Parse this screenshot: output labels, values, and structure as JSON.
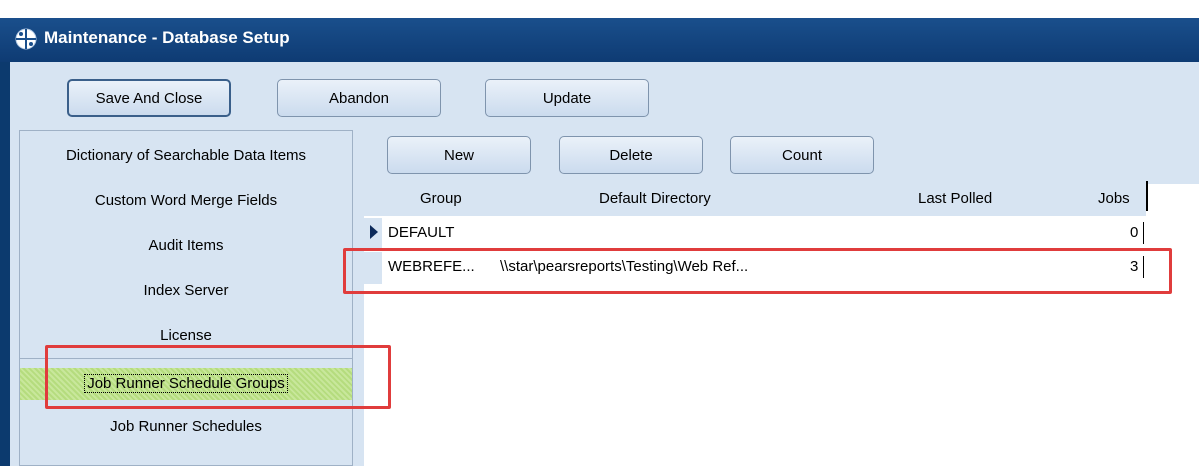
{
  "window": {
    "title": "Maintenance - Database Setup",
    "icon": "database-setup-icon"
  },
  "toolbar": {
    "save_label": "Save And Close",
    "abandon_label": "Abandon",
    "update_label": "Update"
  },
  "sidebar": {
    "items": [
      {
        "label": "Dictionary of Searchable Data Items"
      },
      {
        "label": "Custom Word Merge Fields"
      },
      {
        "label": "Audit Items"
      },
      {
        "label": "Index Server"
      },
      {
        "label": "License"
      },
      {
        "label": "Job Runner Schedule Groups",
        "selected": true
      },
      {
        "label": "Job Runner Schedules"
      }
    ]
  },
  "grid_toolbar": {
    "new_label": "New",
    "delete_label": "Delete",
    "count_label": "Count"
  },
  "grid": {
    "columns": [
      "Group",
      "Default Directory",
      "Last Polled",
      "Jobs"
    ],
    "rows": [
      {
        "group": "DEFAULT",
        "directory": "",
        "last_polled": "",
        "jobs": "0",
        "current": true
      },
      {
        "group": "WEBREFE...",
        "directory": "\\\\star\\pearsreports\\Testing\\Web Ref...",
        "last_polled": "",
        "jobs": "3",
        "current": false
      }
    ]
  },
  "colors": {
    "titlebar": "#0e3b73",
    "panel_bg": "#d7e4f2",
    "selected_item": "#bde08a",
    "annotation_box": "#e03c3c"
  }
}
